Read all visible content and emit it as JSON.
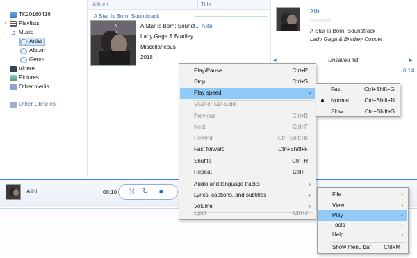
{
  "nav": {
    "root": "TK20180416",
    "items": [
      "Playlists",
      "Music",
      "Artist",
      "Album",
      "Genre",
      "Videos",
      "Pictures",
      "Other media"
    ],
    "other_libraries": "Other Libraries"
  },
  "header": {
    "album_col": "Album",
    "title_col": "Title"
  },
  "album_group": {
    "title": "A Star Is Born: Soundtrack",
    "album": "A Star Is Born: Soundt...",
    "artist": "Lady Gaga & Bradley ...",
    "genre": "Miscellaneous",
    "year": "2018",
    "track": "Alibi"
  },
  "now_playing": {
    "title": "Alibi",
    "stars": "☆☆☆☆☆",
    "album": "A Star Is Born: Soundtrack",
    "artist": "Lady Gaga & Bradley Cooper",
    "list_label": "Unsaved list",
    "time": "0:14"
  },
  "player": {
    "title": "Alibi",
    "time": "00:10"
  },
  "context_menu": {
    "items": [
      {
        "label": "Play/Pause",
        "shortcut": "Ctrl+P"
      },
      {
        "label": "Stop",
        "shortcut": "Ctrl+S"
      },
      {
        "label": "Play speed",
        "shortcut": ""
      },
      {
        "label": "VCD or CD audio",
        "shortcut": ""
      },
      {
        "label": "Previous",
        "shortcut": "Ctrl+B"
      },
      {
        "label": "Next",
        "shortcut": "Ctrl+F"
      },
      {
        "label": "Rewind",
        "shortcut": "Ctrl+Shift+B"
      },
      {
        "label": "Fast forward",
        "shortcut": "Ctrl+Shift+F"
      },
      {
        "label": "Shuffle",
        "shortcut": "Ctrl+H"
      },
      {
        "label": "Repeat",
        "shortcut": "Ctrl+T"
      },
      {
        "label": "Audio and language tracks",
        "shortcut": ""
      },
      {
        "label": "Lyrics, captions, and subtitles",
        "shortcut": ""
      },
      {
        "label": "Volume",
        "shortcut": ""
      },
      {
        "label": "Eject",
        "shortcut": "Ctrl+J"
      }
    ]
  },
  "speed_menu": {
    "items": [
      {
        "label": "Fast",
        "shortcut": "Ctrl+Shift+G"
      },
      {
        "label": "Normal",
        "shortcut": "Ctrl+Shift+N"
      },
      {
        "label": "Slow",
        "shortcut": "Ctrl+Shift+S"
      }
    ]
  },
  "main_menu": {
    "items": [
      {
        "label": "File",
        "shortcut": ""
      },
      {
        "label": "View",
        "shortcut": ""
      },
      {
        "label": "Play",
        "shortcut": ""
      },
      {
        "label": "Tools",
        "shortcut": ""
      },
      {
        "label": "Help",
        "shortcut": ""
      },
      {
        "label": "Show menu bar",
        "shortcut": "Ctrl+M"
      }
    ]
  },
  "colors": {
    "highlight": "#91c9f7",
    "accent": "#2f6db3"
  }
}
